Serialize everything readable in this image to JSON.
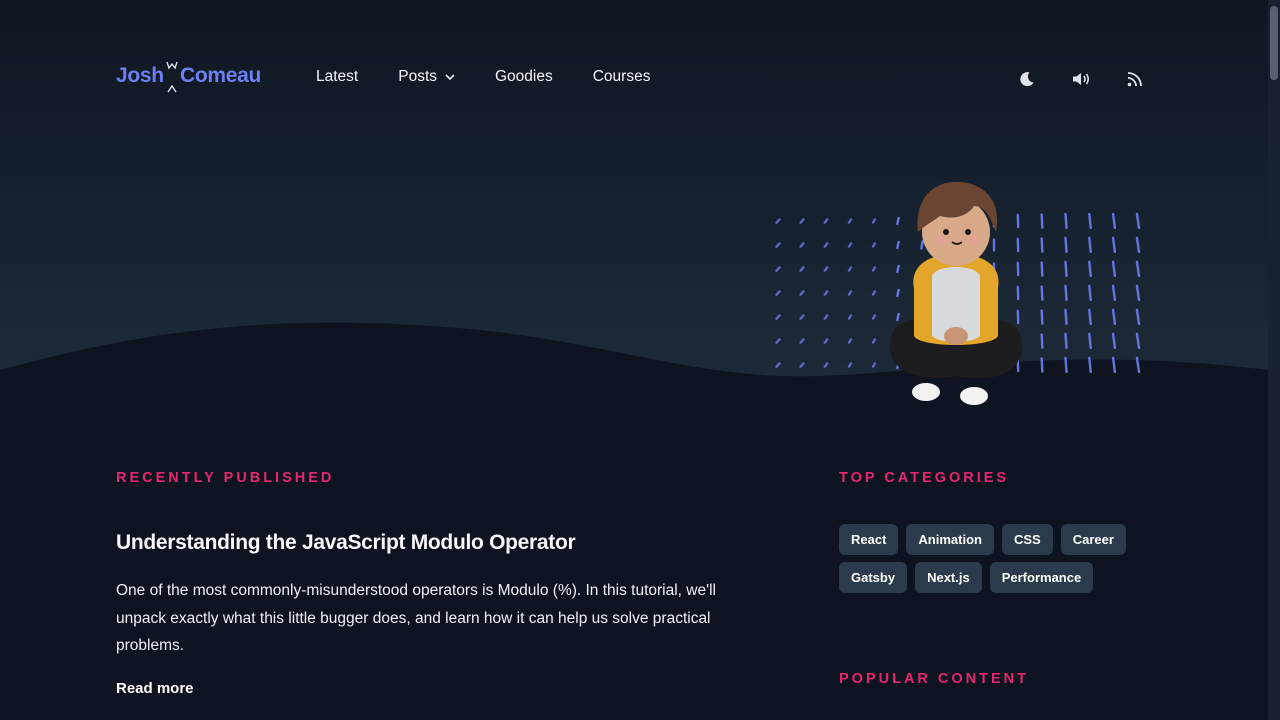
{
  "logo": {
    "first": "Josh",
    "last": "Comeau"
  },
  "nav": [
    {
      "label": "Latest",
      "has_menu": false
    },
    {
      "label": "Posts",
      "has_menu": true
    },
    {
      "label": "Goodies",
      "has_menu": false
    },
    {
      "label": "Courses",
      "has_menu": false
    }
  ],
  "actions": [
    {
      "name": "dark-mode-toggle",
      "icon": "moon-icon"
    },
    {
      "name": "sound-toggle",
      "icon": "speaker-icon"
    },
    {
      "name": "rss-feed-link",
      "icon": "rss-icon"
    }
  ],
  "recent": {
    "label": "RECENTLY PUBLISHED",
    "post_title": "Understanding the JavaScript Modulo Operator",
    "excerpt": "One of the most commonly-misunderstood operators is Modulo (%). In this tutorial, we'll unpack exactly what this little bugger does, and learn how it can help us solve practical problems.",
    "read_more": "Read more"
  },
  "sidebar": {
    "categories_label": "TOP CATEGORIES",
    "categories": [
      "React",
      "Animation",
      "CSS",
      "Career",
      "Gatsby",
      "Next.js",
      "Performance"
    ],
    "popular_label": "POPULAR CONTENT"
  },
  "colors": {
    "brand": "#6d7ff5",
    "accent": "#e5276e",
    "pill_bg": "#2b3b4b",
    "background": "#0d131f"
  }
}
